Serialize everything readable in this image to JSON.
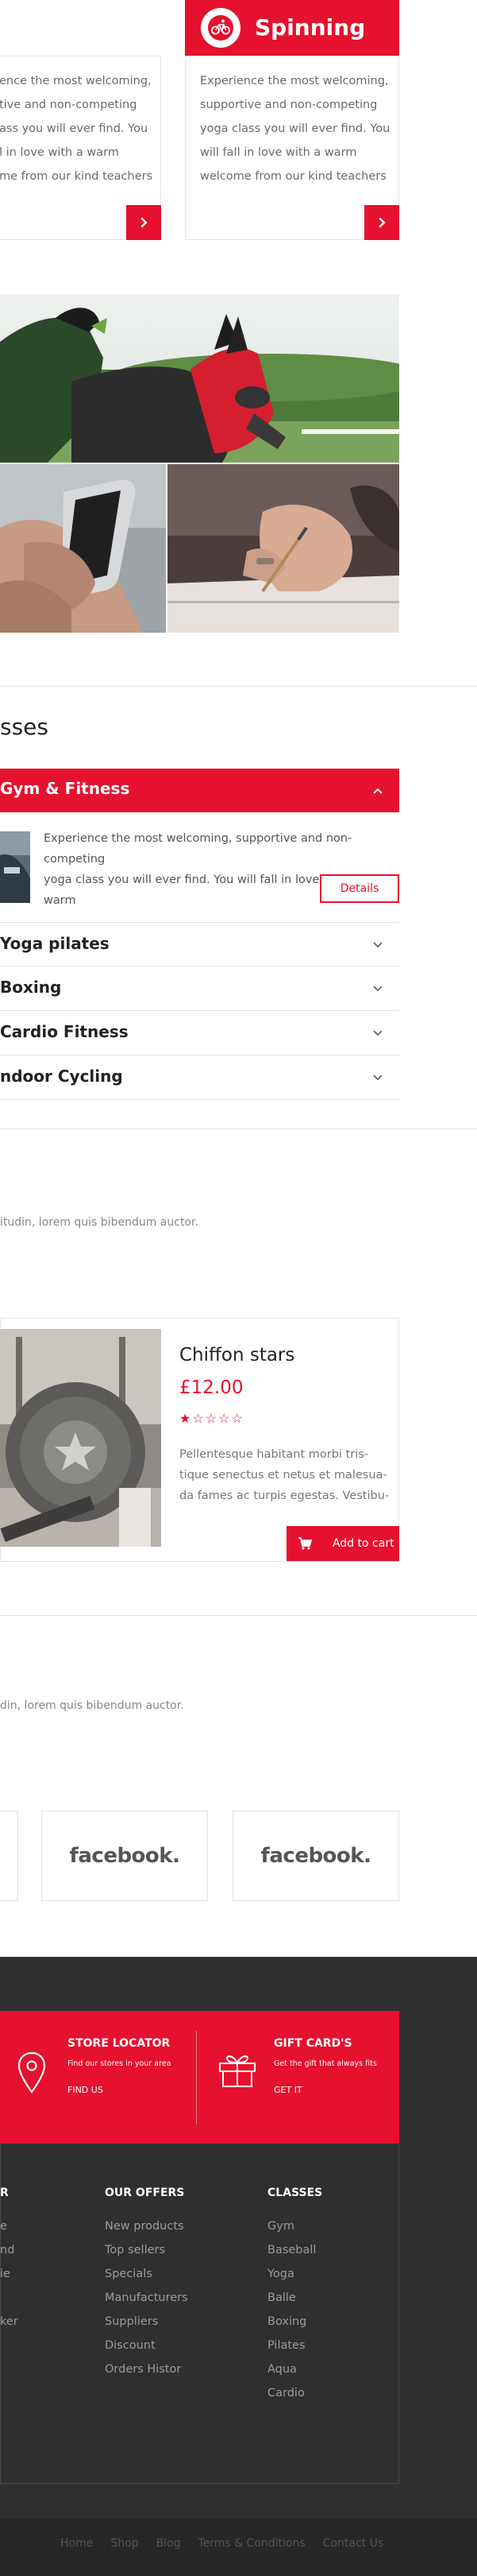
{
  "classes_cards": {
    "left_card_text": [
      "ence the most welcoming,",
      "tive and non-competing",
      "ass you will ever find. You",
      "l in love with a warm",
      "me from our kind teachers"
    ],
    "spinning": {
      "title": "Spinning",
      "text": [
        "Experience the most welcoming,",
        "supportive and non-competing",
        "yoga class you will ever find. You",
        "will fall in love with a warm",
        "welcome from our kind teachers"
      ]
    }
  },
  "classes_section": {
    "title": "sses",
    "active": {
      "title": "Gym & Fitness",
      "text": [
        "Experience the most welcoming, supportive and non-competing",
        "yoga class you will ever find. You will fall in love with a warm"
      ],
      "details_label": "Details"
    },
    "items": [
      "Yoga pilates",
      "Boxing",
      "Cardio Fitness",
      "ndoor Cycling"
    ]
  },
  "products_section": {
    "subtitle_fragment": "itudin, lorem quis bibendum auctor.",
    "product": {
      "name": "Chiffon stars",
      "price": "£12.00",
      "rating": 1,
      "rating_out_of": 5,
      "stars_text": "★☆☆☆☆",
      "description": [
        "Pellentesque habitant morbi tris-",
        "tique senectus et netus et malesua-",
        "da fames ac turpis egestas. Vestibu-"
      ],
      "add_to_cart_label": "Add to cart"
    }
  },
  "brands_section": {
    "subtitle_fragment": "din, lorem quis bibendum auctor.",
    "brands": [
      "facebook.",
      "facebook."
    ]
  },
  "footer": {
    "store_locator": {
      "title": "STORE LOCATOR",
      "sub": "Find our stores in your area",
      "link": "FIND US"
    },
    "gift_cards": {
      "title": "GIFT CARD'S",
      "sub": "Get the gift that always fits",
      "link": "GET IT"
    },
    "col_left": {
      "title": "R",
      "items": [
        "e",
        "nd",
        "ie",
        "",
        "ker"
      ]
    },
    "our_offers": {
      "title": "OUR OFFERS",
      "items": [
        "New products",
        "Top sellers",
        "Specials",
        "Manufacturers",
        "Suppliers",
        "Discount",
        "Orders Histor"
      ]
    },
    "classes": {
      "title": "CLASSES",
      "items": [
        "Gym",
        "Baseball",
        "Yoga",
        "Balle",
        "Boxing",
        "Pilates",
        "Aqua",
        "Cardio"
      ]
    },
    "bottom_links": [
      "Home",
      "Shop",
      "Blog",
      "Terms & Conditions",
      "Contact Us"
    ]
  },
  "colors": {
    "accent": "#e5112f",
    "footer_bg": "#2f2f2f",
    "bottom_bar": "#272727"
  }
}
